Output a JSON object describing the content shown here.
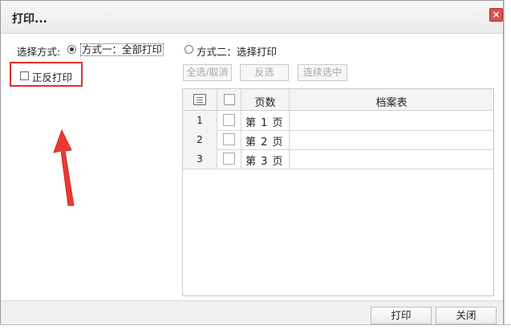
{
  "dialog": {
    "title": "打印...",
    "close_icon": "×"
  },
  "mode": {
    "label": "选择方式:",
    "option1": "方式一：全部打印",
    "option1_selected": true,
    "option2": "方式二：选择打印",
    "option2_selected": false
  },
  "duplex": {
    "label": "正反打印",
    "checked": false
  },
  "toolbar": {
    "select_all": "全选/取消",
    "invert": "反选",
    "range_select": "连续选中"
  },
  "table": {
    "columns": {
      "page": "页数",
      "doc": "档案表"
    },
    "rows": [
      {
        "index": "1",
        "page": "第 1 页",
        "doc": ""
      },
      {
        "index": "2",
        "page": "第 2 页",
        "doc": ""
      },
      {
        "index": "3",
        "page": "第 3 页",
        "doc": ""
      }
    ]
  },
  "footer": {
    "print": "打印",
    "close": "关闭"
  },
  "colors": {
    "highlight": "#e0302a",
    "close_button": "#d9534f"
  },
  "icons": [
    "close-icon",
    "list-icon",
    "arrow-annotation"
  ]
}
